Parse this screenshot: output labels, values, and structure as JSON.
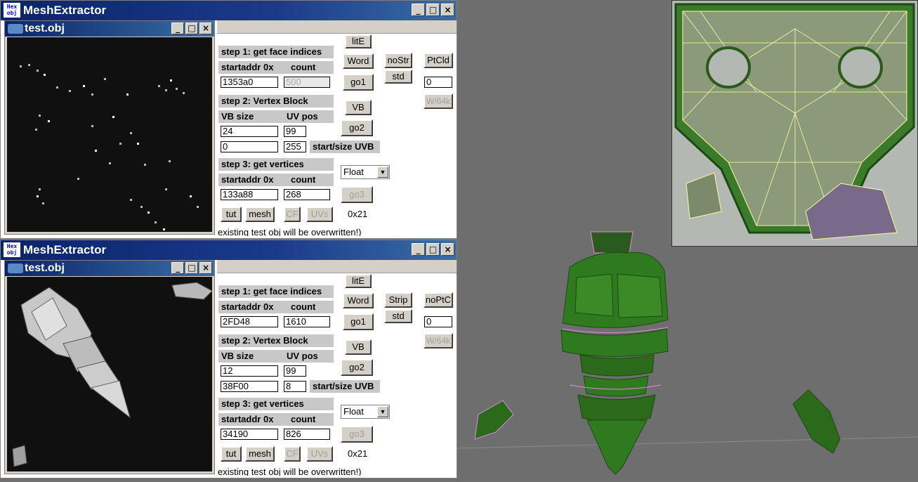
{
  "windows": [
    {
      "title": "MeshExtractor",
      "logo_text": "Hex obj",
      "child_title": "test.obj",
      "step1": {
        "heading": "step 1: get face indices",
        "startaddr_label": "startaddr 0x",
        "count_label": "count",
        "startaddr": "1353a0",
        "count": "500"
      },
      "step2": {
        "heading": "step 2: Vertex Block",
        "vbsize_label": "VB size",
        "uvpos_label": "UV pos",
        "vbsize": "24",
        "uvpos": "99",
        "start": "0",
        "size": "255",
        "startsize_label": "start/size UVB"
      },
      "step3": {
        "heading": "step 3: get vertices",
        "startaddr_label": "startaddr 0x",
        "count_label": "count",
        "startaddr": "133a88",
        "count": "268"
      },
      "buttons": {
        "lite": "litE",
        "word": "Word",
        "strip": "noStr",
        "ptcld": "PtCld",
        "go1": "go1",
        "std": "std",
        "vb": "VB",
        "go2": "go2",
        "go3": "go3",
        "tut": "tut",
        "mesh": "mesh",
        "cf": "CF",
        "uvs": "UVs",
        "w64k": "W/64k"
      },
      "ptcld_value": "0",
      "format": "Float",
      "hex_value": "0x21",
      "footer": "existing test obj will be overwritten!)"
    },
    {
      "title": "MeshExtractor",
      "logo_text": "Hex obj",
      "child_title": "test.obj",
      "step1": {
        "heading": "step 1: get face indices",
        "startaddr_label": "startaddr 0x",
        "count_label": "count",
        "startaddr": "2FD48",
        "count": "1610"
      },
      "step2": {
        "heading": "step 2: Vertex Block",
        "vbsize_label": "VB size",
        "uvpos_label": "UV pos",
        "vbsize": "12",
        "uvpos": "99",
        "start": "38F00",
        "size": "8",
        "startsize_label": "start/size UVB"
      },
      "step3": {
        "heading": "step 3: get vertices",
        "startaddr_label": "startaddr 0x",
        "count_label": "count",
        "startaddr": "34190",
        "count": "826"
      },
      "buttons": {
        "lite": "litE",
        "word": "Word",
        "strip": "Strip",
        "ptcld": "noPtC",
        "go1": "go1",
        "std": "std",
        "vb": "VB",
        "go2": "go2",
        "go3": "go3",
        "tut": "tut",
        "mesh": "mesh",
        "cf": "CF",
        "uvs": "UVs",
        "w64k": "W/64k"
      },
      "ptcld_value": "0",
      "format": "Float",
      "hex_value": "0x21",
      "footer": "existing test obj will be overwritten!)"
    }
  ],
  "icons": {
    "minimize": "minimize-icon",
    "maximize": "maximize-icon",
    "close": "close-icon",
    "dropdown": "chevron-down-icon"
  },
  "colors": {
    "titlebar": "#0a246a",
    "mesh_green": "#2f7a1f",
    "wireframe_pink": "#e08ae0",
    "uv_lines": "#fffca0"
  }
}
